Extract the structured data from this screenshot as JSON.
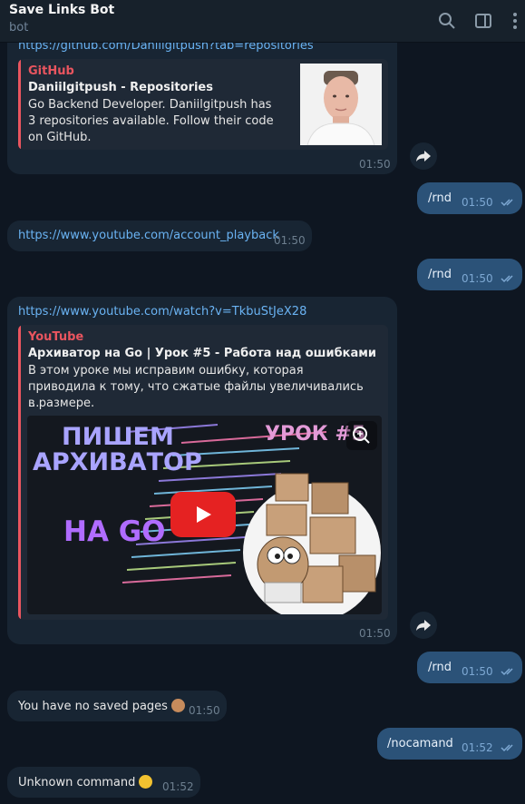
{
  "header": {
    "title": "Save Links Bot",
    "subtitle": "bot",
    "icons": [
      "search-icon",
      "sidebar-toggle-icon",
      "more-vertical-icon"
    ]
  },
  "messages": {
    "m1": {
      "link": "https://github.com/Daniilgitpush?tab=repositories",
      "site": "GitHub",
      "title": "Daniilgitpush - Repositories",
      "desc": "Go Backend Developer. Daniilgitpush has 3 repositories available. Follow their code on GitHub.",
      "time": "01:50"
    },
    "m2": {
      "text": "/rnd",
      "time": "01:50"
    },
    "m3": {
      "link": "https://www.youtube.com/account_playback",
      "time": "01:50"
    },
    "m4": {
      "text": "/rnd",
      "time": "01:50"
    },
    "m5": {
      "link": "https://www.youtube.com/watch?v=TkbuStJeX28",
      "site": "YouTube",
      "title": "Архиватор на Go | Урок #5 - Работа над ошибками",
      "desc": "В этом уроке мы исправим ошибку, которая приводила к тому, что сжатые файлы увеличивались в размере.",
      "ellipsis": "...",
      "thumb_line1": "ПИШЕМ",
      "thumb_line2": "АРХИВАТОР",
      "thumb_line3": "НА GO",
      "thumb_lesson": "УРОК #5",
      "time": "01:50"
    },
    "m6": {
      "text": "/rnd",
      "time": "01:50"
    },
    "m7": {
      "text": "You have no saved pages",
      "emoji": "monkey-emoji",
      "time": "01:50"
    },
    "m8": {
      "text": "/nocamand",
      "time": "01:52"
    },
    "m9": {
      "text": "Unknown command",
      "emoji": "thinking-face-emoji",
      "time": "01:52"
    }
  },
  "colors": {
    "background": "#0e1621",
    "incoming": "#182533",
    "outgoing": "#2b5278",
    "link": "#6ab3f3",
    "accent_red": "#e9555f"
  }
}
